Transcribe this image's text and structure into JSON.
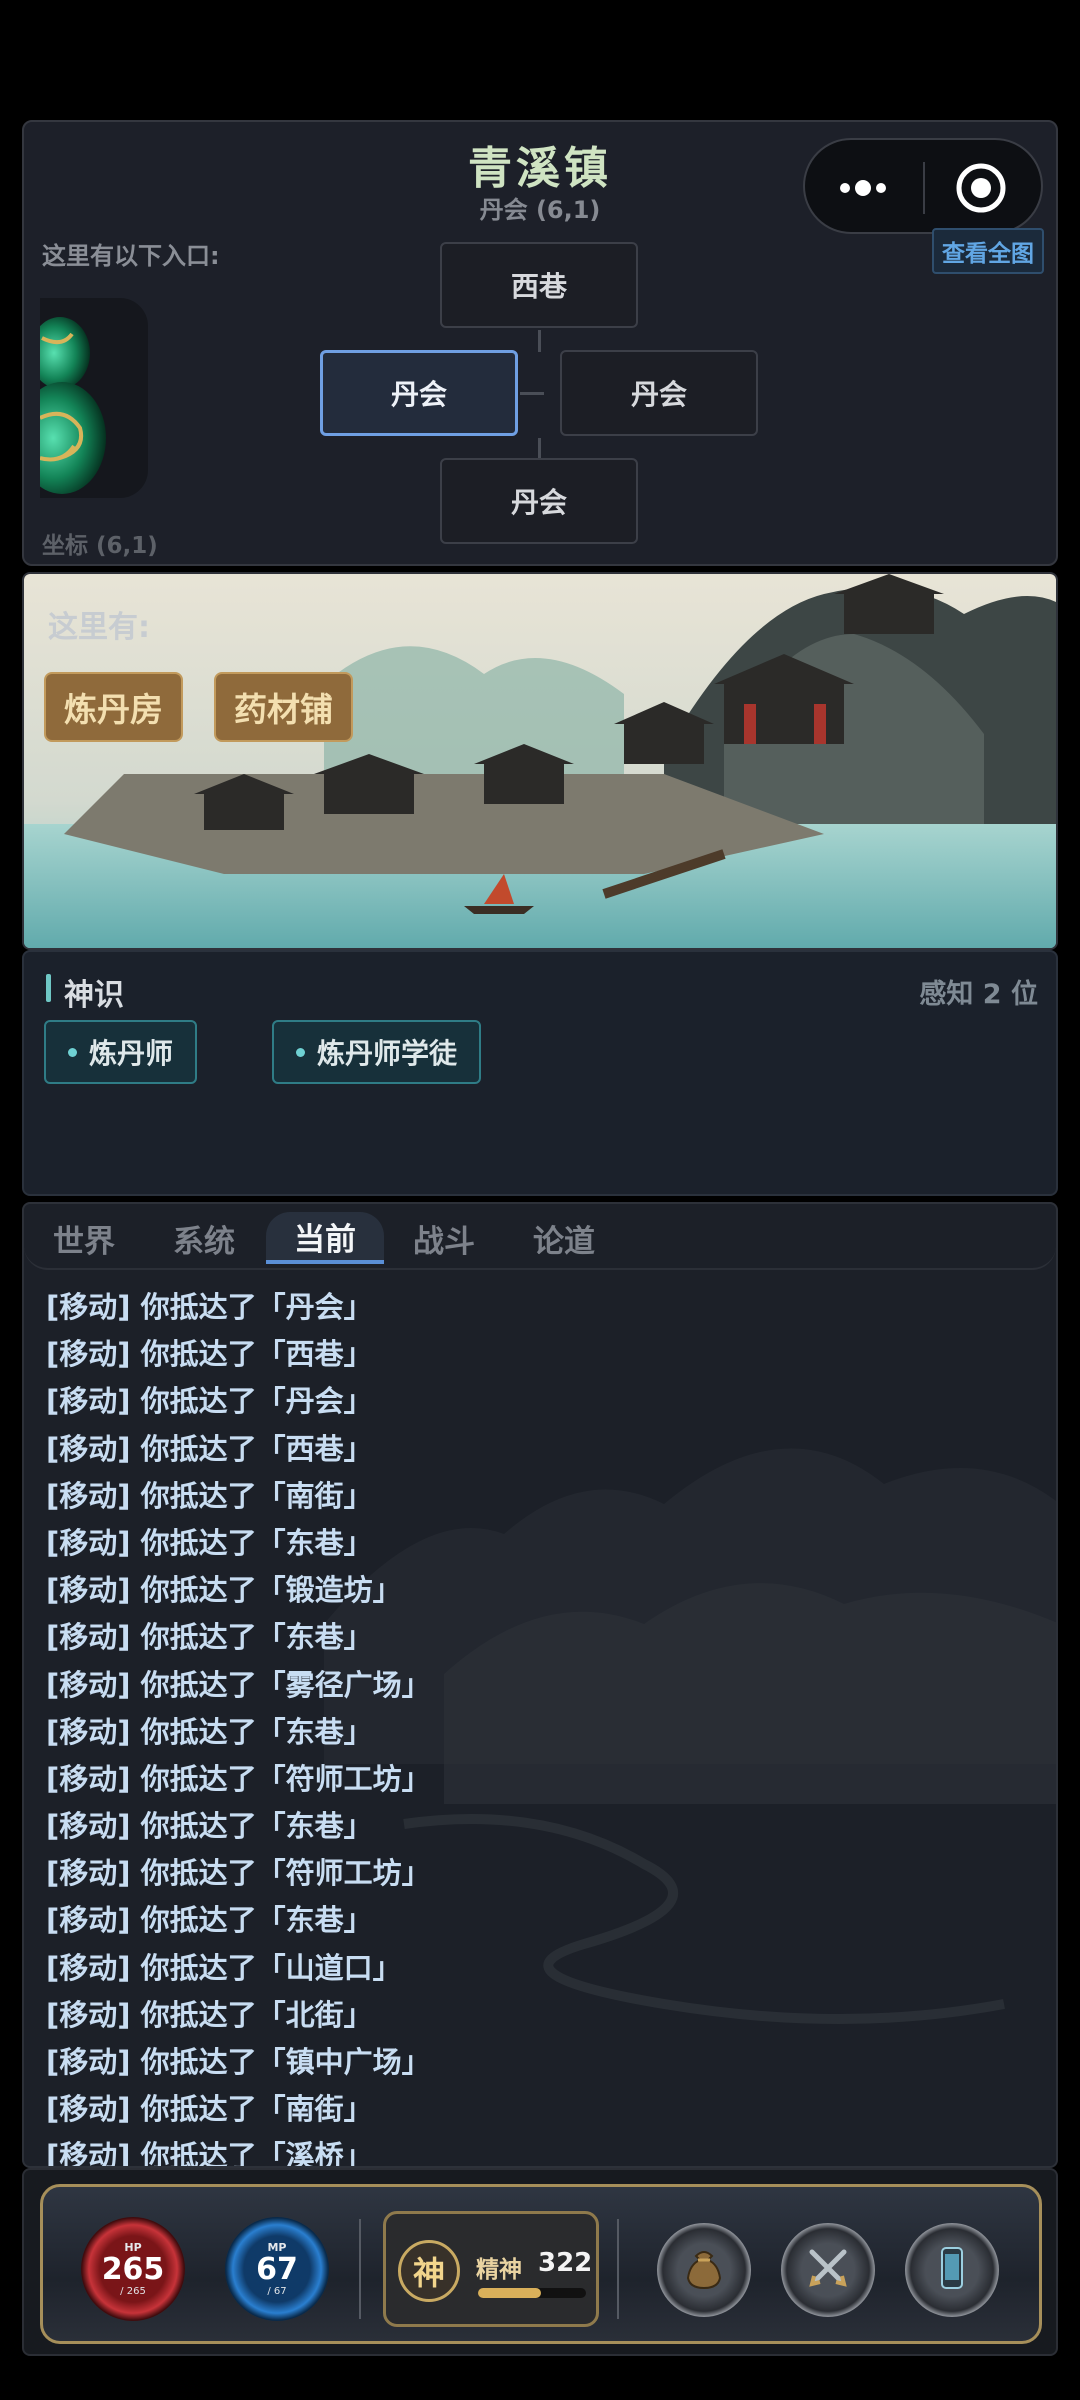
{
  "location": {
    "title": "青溪镇",
    "subtitle": "丹会 (6,1)",
    "entrances_label": "这里有以下入口:",
    "coord_label": "坐标 (6,1)",
    "view_map_label": "查看全图",
    "nodes": {
      "north": "西巷",
      "current": "丹会",
      "east": "丹会",
      "south": "丹会"
    }
  },
  "capsule": {
    "more_icon": "more-dots-icon",
    "close_icon": "target-circle-icon"
  },
  "scene": {
    "label": "这里有:",
    "facilities": [
      "炼丹房",
      "药材铺"
    ]
  },
  "sense": {
    "title": "神识",
    "count": "感知 2 位",
    "npcs": [
      "炼丹师",
      "炼丹师学徒"
    ]
  },
  "chat": {
    "tabs": [
      "世界",
      "系统",
      "当前",
      "战斗",
      "论道"
    ],
    "active_tab": "当前",
    "log": [
      "[移动] 你抵达了「丹会」",
      "[移动] 你抵达了「西巷」",
      "[移动] 你抵达了「丹会」",
      "[移动] 你抵达了「西巷」",
      "[移动] 你抵达了「南街」",
      "[移动] 你抵达了「东巷」",
      "[移动] 你抵达了「锻造坊」",
      "[移动] 你抵达了「东巷」",
      "[移动] 你抵达了「雾径广场」",
      "[移动] 你抵达了「东巷」",
      "[移动] 你抵达了「符师工坊」",
      "[移动] 你抵达了「东巷」",
      "[移动] 你抵达了「符师工坊」",
      "[移动] 你抵达了「东巷」",
      "[移动] 你抵达了「山道口」",
      "[移动] 你抵达了「北街」",
      "[移动] 你抵达了「镇中广场」",
      "[移动] 你抵达了「南街」",
      "[移动] 你抵达了「溪桥」"
    ]
  },
  "status": {
    "hp_label": "HP",
    "hp": "265",
    "hp_max": "/ 265",
    "mp_label": "MP",
    "mp": "67",
    "mp_max": "/ 67",
    "spirit_badge": "神",
    "spirit_label": "精神",
    "spirit_value": "322",
    "spirit_fill": 0.58,
    "buttons": [
      "bag-icon",
      "swords-icon",
      "phone-icon"
    ]
  },
  "colors": {
    "accent": "#6f9fe3",
    "teal": "#6fc7c5",
    "gold": "#a68f5a"
  }
}
